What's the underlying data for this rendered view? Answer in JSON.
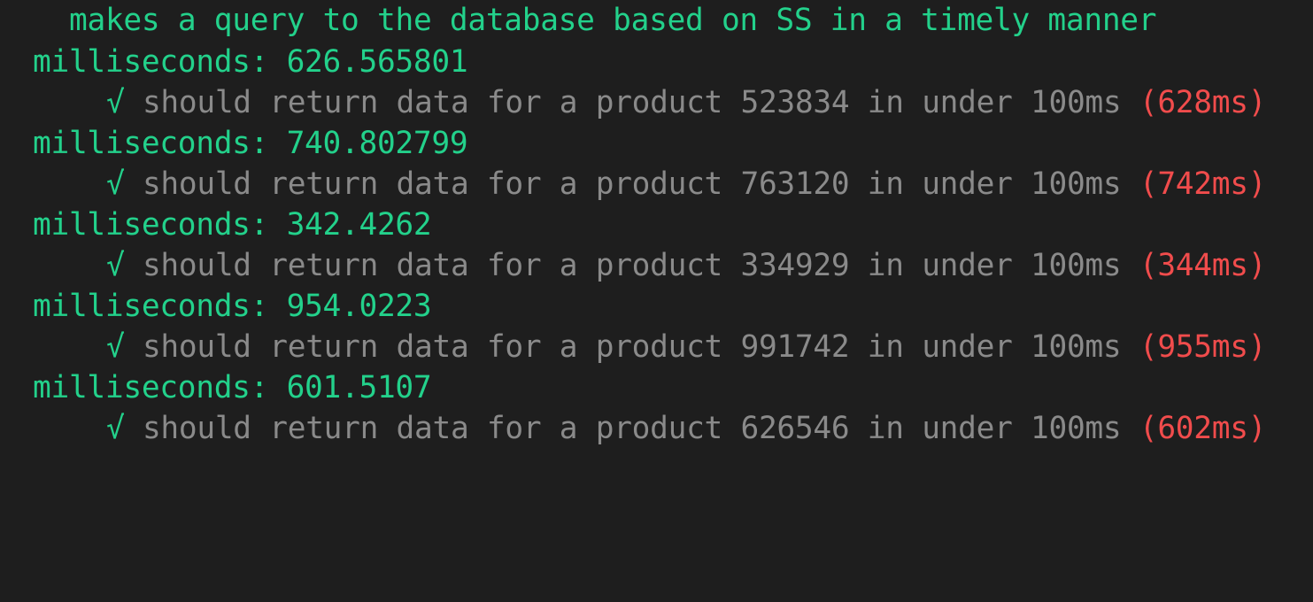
{
  "terminal": {
    "suite_title": "makes a query to the database based on SS in a timely manner",
    "entries": [
      {
        "ms_label": "milliseconds: 626.565801",
        "check": "√",
        "test_text": " should return data for a product 523834 in under 100ms ",
        "duration": "(628ms)"
      },
      {
        "ms_label": "milliseconds: 740.802799",
        "check": "√",
        "test_text": " should return data for a product 763120 in under 100ms ",
        "duration": "(742ms)"
      },
      {
        "ms_label": "milliseconds: 342.4262",
        "check": "√",
        "test_text": " should return data for a product 334929 in under 100ms ",
        "duration": "(344ms)"
      },
      {
        "ms_label": "milliseconds: 954.0223",
        "check": "√",
        "test_text": " should return data for a product 991742 in under 100ms ",
        "duration": "(955ms)"
      },
      {
        "ms_label": "milliseconds: 601.5107",
        "check": "√",
        "test_text": " should return data for a product 626546 in under 100ms ",
        "duration": "(602ms)"
      }
    ]
  },
  "colors": {
    "background": "#1e1e1e",
    "pass_green": "#23d18b",
    "test_gray": "#8a8a8a",
    "slow_red": "#f14c4c"
  }
}
